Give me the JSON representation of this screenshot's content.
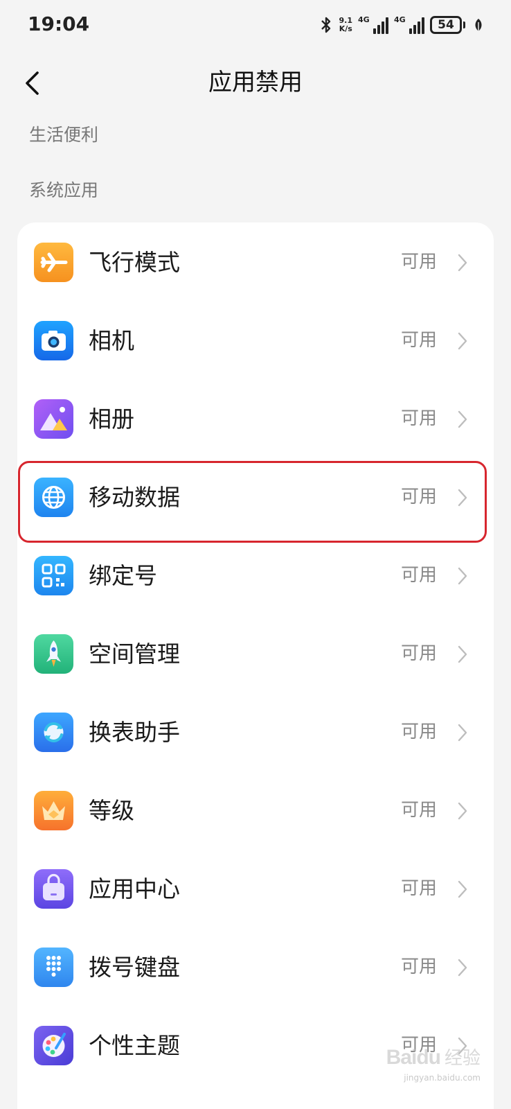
{
  "status_bar": {
    "time": "19:04",
    "net_speed_value": "9.1",
    "net_speed_unit": "K/s",
    "signal1_tag": "4G",
    "signal2_tag": "4G",
    "battery": "54",
    "icons": [
      "bluetooth-icon",
      "signal-icon",
      "battery-icon",
      "leaf-icon"
    ]
  },
  "header": {
    "back_icon": "chevron-left-icon",
    "title": "应用禁用"
  },
  "sections": {
    "life": "生活便利",
    "system": "系统应用"
  },
  "items": [
    {
      "label": "飞行模式",
      "status": "可用",
      "icon": "airplane-icon",
      "color": "#f7a72e"
    },
    {
      "label": "相机",
      "status": "可用",
      "icon": "camera-icon",
      "color": "#2f8cf6"
    },
    {
      "label": "相册",
      "status": "可用",
      "icon": "gallery-icon",
      "color": "#9b5cf0"
    },
    {
      "label": "移动数据",
      "status": "可用",
      "icon": "globe-icon",
      "color": "#2a9cf5"
    },
    {
      "label": "绑定号",
      "status": "可用",
      "icon": "qr-code-icon",
      "color": "#2a9cf5"
    },
    {
      "label": "空间管理",
      "status": "可用",
      "icon": "rocket-icon",
      "color": "#3ec98c"
    },
    {
      "label": "换表助手",
      "status": "可用",
      "icon": "sync-icon",
      "color": "#3d8ff5"
    },
    {
      "label": "等级",
      "status": "可用",
      "icon": "crown-icon",
      "color": "#f98b36"
    },
    {
      "label": "应用中心",
      "status": "可用",
      "icon": "bag-icon",
      "color": "#7d5cf0"
    },
    {
      "label": "拨号键盘",
      "status": "可用",
      "icon": "dialpad-icon",
      "color": "#4aa3f5"
    },
    {
      "label": "个性主题",
      "status": "可用",
      "icon": "palette-icon",
      "color": "#6a4fe0"
    }
  ],
  "watermark": {
    "logo": "Baidu",
    "text": "经验",
    "url": "jingyan.baidu.com"
  }
}
